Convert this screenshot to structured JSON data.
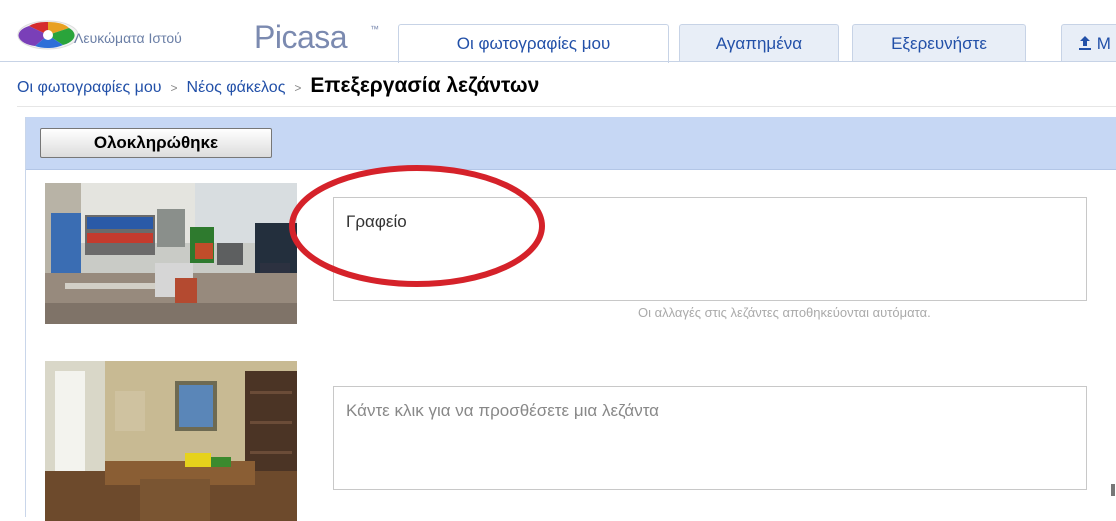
{
  "header": {
    "brand_small": "Λευκώματα Ιστού",
    "brand_name": "Picasa",
    "brand_tm": "™",
    "tabs": [
      {
        "label": "Οι φωτογραφίες μου",
        "active": true
      },
      {
        "label": "Αγαπημένα",
        "active": false
      },
      {
        "label": "Εξερευνήστε",
        "active": false
      }
    ],
    "upload_label": "Μ"
  },
  "breadcrumb": {
    "items": [
      "Οι φωτογραφίες μου",
      "Νέος φάκελος"
    ],
    "separator": ">",
    "current": "Επεξεργασία λεζάντων"
  },
  "toolbar": {
    "done_label": "Ολοκληρώθηκε"
  },
  "photos": [
    {
      "caption_value": "Γραφείο",
      "autosave_note": "Οι αλλαγές στις λεζάντες αποθηκεύονται αυτόματα."
    },
    {
      "caption_placeholder": "Κάντε κλικ για να προσθέσετε μια λεζάντα"
    }
  ],
  "colors": {
    "accent": "#2250a8",
    "toolbar_bg": "#c6d7f4",
    "highlight": "#d5222a"
  },
  "icons": [
    "picasa-logo-icon",
    "upload-icon"
  ]
}
